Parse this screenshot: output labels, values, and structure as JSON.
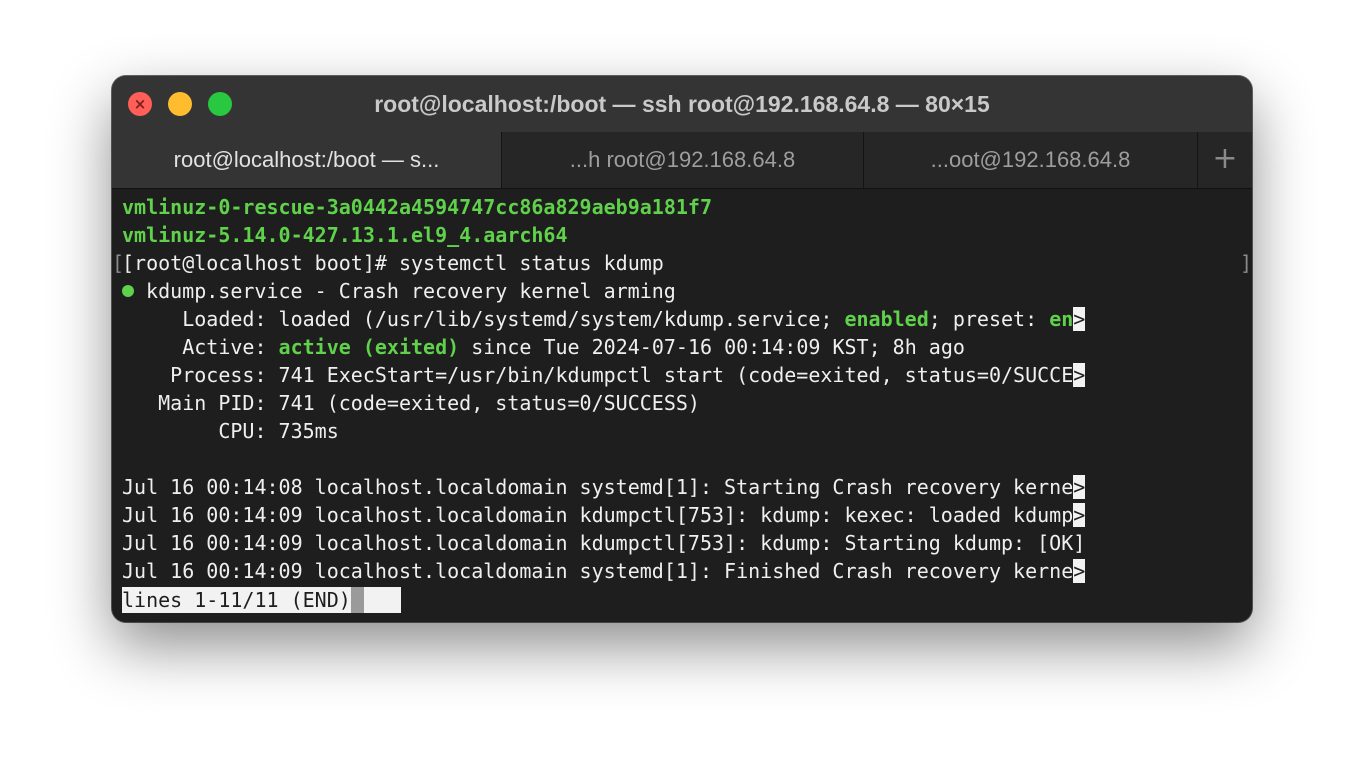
{
  "window": {
    "title": "root@localhost:/boot — ssh root@192.168.64.8 — 80×15",
    "traffic_lights": {
      "close_glyph": "×"
    }
  },
  "tabs": [
    {
      "label": "root@localhost:/boot — s...",
      "active": true
    },
    {
      "label": "...h root@192.168.64.8",
      "active": false
    },
    {
      "label": "...oot@192.168.64.8",
      "active": false
    }
  ],
  "tab_add_label": "+",
  "terminal": {
    "colors": {
      "green": "#5fd14a",
      "text": "#efefef",
      "background": "#1e1e1e"
    },
    "file1": "vmlinuz-0-rescue-3a0442a4594747cc86a829aeb9a181f7",
    "file2": "vmlinuz-5.14.0-427.13.1.el9_4.aarch64",
    "prompt_open": "[",
    "prompt_close": "]",
    "prompt": "[root@localhost boot]# systemctl status kdump",
    "status_dot": "●",
    "service_line": " kdump.service - Crash recovery kernel arming",
    "loaded_a": "     Loaded: loaded (/usr/lib/systemd/system/kdump.service; ",
    "loaded_enabled": "enabled",
    "loaded_b": "; preset: ",
    "loaded_en": "en",
    "active_a": "     Active: ",
    "active_state": "active (exited)",
    "active_b": " since Tue 2024-07-16 00:14:09 KST; 8h ago",
    "process": "    Process: 741 ExecStart=/usr/bin/kdumpctl start (code=exited, status=0/SUCCE",
    "main_pid": "   Main PID: 741 (code=exited, status=0/SUCCESS)",
    "cpu": "        CPU: 735ms",
    "log1": "Jul 16 00:14:08 localhost.localdomain systemd[1]: Starting Crash recovery kerne",
    "log2": "Jul 16 00:14:09 localhost.localdomain kdumpctl[753]: kdump: kexec: loaded kdump",
    "log3": "Jul 16 00:14:09 localhost.localdomain kdumpctl[753]: kdump: Starting kdump: [OK]",
    "log4": "Jul 16 00:14:09 localhost.localdomain systemd[1]: Finished Crash recovery kerne",
    "truncation_marker": ">",
    "pager": "lines 1-11/11 (END)"
  }
}
